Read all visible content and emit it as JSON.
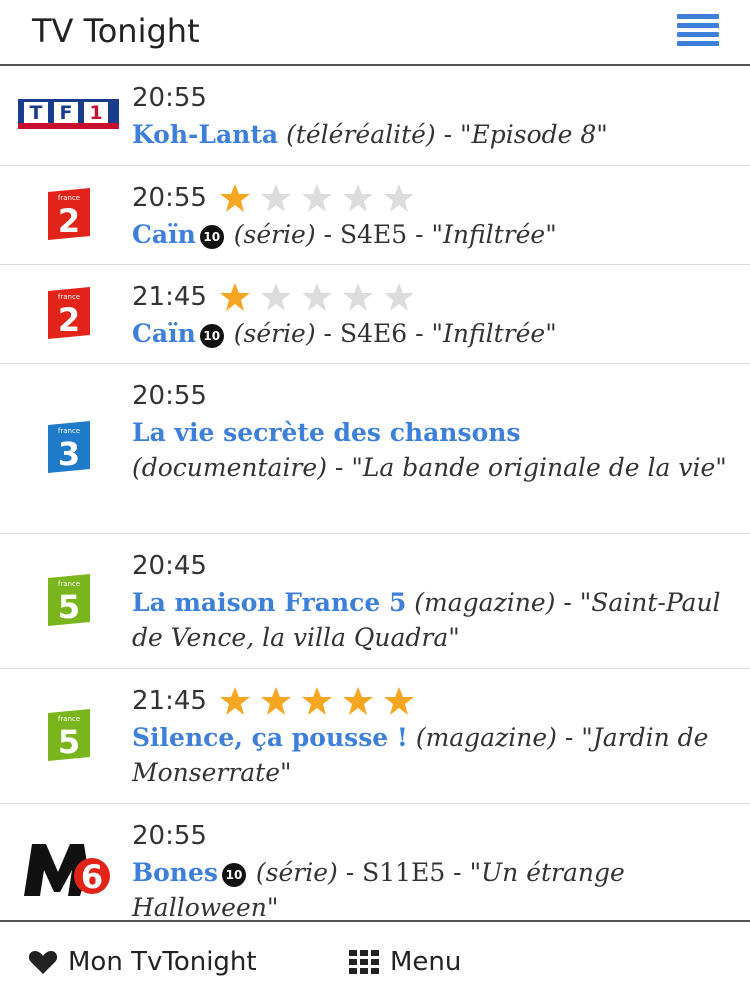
{
  "app": {
    "title": "TV Tonight"
  },
  "footer": {
    "favorites_label": "Mon TvTonight",
    "menu_label": "Menu"
  },
  "programs": [
    {
      "channel": "TF1",
      "time": "20:55",
      "rating": null,
      "title": "Koh-Lanta",
      "age": "",
      "genre": "(téléréalité)",
      "sep": " - ",
      "episode": "",
      "ep_title": "\"Episode 8\""
    },
    {
      "channel": "France 2",
      "time": "20:55",
      "rating": 1,
      "title": "Caïn",
      "age": "10",
      "genre": "(série)",
      "sep": " - ",
      "episode": "S4E5 - ",
      "ep_title": "\"Infiltrée\""
    },
    {
      "channel": "France 2",
      "time": "21:45",
      "rating": 1,
      "title": "Caïn",
      "age": "10",
      "genre": "(série)",
      "sep": " - ",
      "episode": "S4E6 - ",
      "ep_title": "\"Infiltrée\""
    },
    {
      "channel": "France 3",
      "time": "20:55",
      "rating": null,
      "title": "La vie secrète des chansons",
      "age": "",
      "genre": "(documentaire)",
      "sep": " - ",
      "episode": "",
      "ep_title": "\"La bande originale de la vie\""
    },
    {
      "channel": "France 5",
      "time": "20:45",
      "rating": null,
      "title": "La maison France 5",
      "age": "",
      "genre": "(magazine)",
      "sep": " - ",
      "episode": "",
      "ep_title": "\"Saint-Paul de Vence, la villa Quadra\""
    },
    {
      "channel": "France 5",
      "time": "21:45",
      "rating": 5,
      "title": "Silence, ça pousse !",
      "age": "",
      "genre": "(magazine)",
      "sep": " - ",
      "episode": "",
      "ep_title": "\"Jardin de Monserrate\""
    },
    {
      "channel": "M6",
      "time": "20:55",
      "rating": null,
      "title": "Bones",
      "age": "10",
      "genre": "(série)",
      "sep": " - ",
      "episode": "S11E5 - ",
      "ep_title": "\"Un étrange Halloween\""
    }
  ],
  "colors": {
    "accent": "#3d7fd9",
    "star_on": "#f5a623",
    "star_off": "#dcdcdc"
  }
}
